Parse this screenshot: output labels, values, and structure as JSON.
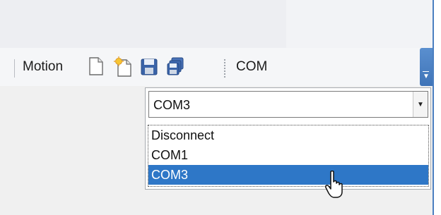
{
  "toolbar": {
    "motion_label": "Motion",
    "com_label": "COM",
    "icons": [
      "new-document-icon",
      "new-sparkle-document-icon",
      "save-icon",
      "save-all-icon"
    ],
    "overflow_icon": "overflow-chevron-icon"
  },
  "com_dropdown": {
    "selected_value": "COM3",
    "options": [
      "Disconnect",
      "COM1",
      "COM3"
    ],
    "highlighted_option": "COM3"
  },
  "colors": {
    "selection": "#2e77c7",
    "accent": "#4b7fc0"
  }
}
